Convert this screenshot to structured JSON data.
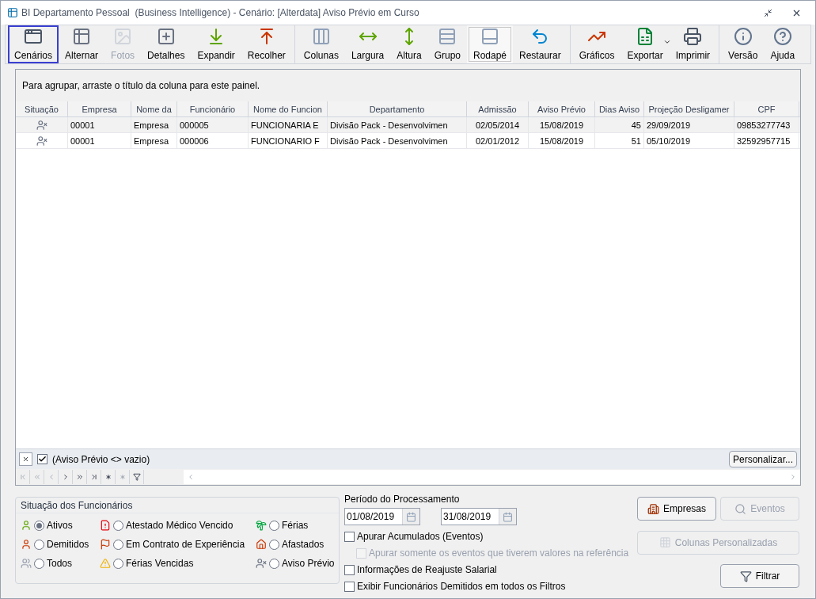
{
  "window": {
    "title": "BI Departamento Pessoal  (Business Intelligence) - Cenário: [Alterdata] Aviso Prévio em Curso"
  },
  "toolbar": [
    [
      {
        "label": "Cenários",
        "kind": "scenarios",
        "selected": true,
        "pressed": false,
        "disabled": false
      },
      {
        "label": "Alternar",
        "kind": "toggle",
        "selected": false,
        "pressed": false,
        "disabled": false
      },
      {
        "label": "Fotos",
        "kind": "photos",
        "selected": false,
        "pressed": false,
        "disabled": true
      },
      {
        "label": "Detalhes",
        "kind": "details",
        "selected": false,
        "pressed": false,
        "disabled": false
      },
      {
        "label": "Expandir",
        "kind": "expand",
        "selected": false,
        "pressed": false,
        "disabled": false
      },
      {
        "label": "Recolher",
        "kind": "collapse",
        "selected": false,
        "pressed": false,
        "disabled": false
      }
    ],
    [
      {
        "label": "Colunas",
        "kind": "columns",
        "selected": false,
        "pressed": false,
        "disabled": false
      },
      {
        "label": "Largura",
        "kind": "width",
        "selected": false,
        "pressed": false,
        "disabled": false
      },
      {
        "label": "Altura",
        "kind": "height",
        "selected": false,
        "pressed": false,
        "disabled": false
      },
      {
        "label": "Grupo",
        "kind": "group",
        "selected": false,
        "pressed": false,
        "disabled": false
      },
      {
        "label": "Rodapé",
        "kind": "footer",
        "selected": false,
        "pressed": true,
        "disabled": false
      },
      {
        "label": "Restaurar",
        "kind": "restore",
        "selected": false,
        "pressed": false,
        "disabled": false
      }
    ],
    [
      {
        "label": "Gráficos",
        "kind": "charts",
        "selected": false,
        "pressed": false,
        "disabled": false
      },
      {
        "label": "Exportar",
        "kind": "export",
        "selected": false,
        "pressed": false,
        "disabled": false,
        "dropdown": true
      },
      {
        "label": "Imprimir",
        "kind": "print",
        "selected": false,
        "pressed": false,
        "disabled": false
      }
    ],
    [
      {
        "label": "Versão",
        "kind": "info",
        "selected": false,
        "pressed": false,
        "disabled": false
      },
      {
        "label": "Ajuda",
        "kind": "help",
        "selected": false,
        "pressed": false,
        "disabled": false
      }
    ]
  ],
  "group_panel": {
    "hint": "Para agrupar, arraste o título da coluna para este painel."
  },
  "table": {
    "columns": [
      "Situação",
      "Empresa",
      "Nome da",
      "Funcionário",
      "Nome do Funcion",
      "Departamento",
      "Admissão",
      "Aviso Prévio",
      "Dias Aviso",
      "Projeção Desligamer",
      "CPF"
    ],
    "rows": [
      [
        "",
        "00001",
        "Empresa",
        "000005",
        "FUNCIONARIA E",
        "Divisão Pack - Desenvolvimen",
        "02/05/2014",
        "15/08/2019",
        "45",
        "29/09/2019",
        "09853277743"
      ],
      [
        "",
        "00001",
        "Empresa",
        "000006",
        "FUNCIONARIO F",
        "Divisão Pack - Desenvolvimen",
        "02/01/2012",
        "15/08/2019",
        "51",
        "05/10/2019",
        "32592957715"
      ]
    ]
  },
  "filter_bar": {
    "enabled": true,
    "text": "(Aviso Prévio <> vazio)",
    "button": "Personalizar..."
  },
  "situacao": {
    "title": "Situação dos Funcionários",
    "options": [
      {
        "label": "Ativos",
        "kind": "active",
        "selected": true
      },
      {
        "label": "Atestado Médico Vencido",
        "kind": "medical",
        "selected": false
      },
      {
        "label": "Férias",
        "kind": "vacation",
        "selected": false
      },
      {
        "label": "Demitidos",
        "kind": "fired",
        "selected": false
      },
      {
        "label": "Em Contrato de Experiência",
        "kind": "trial",
        "selected": false
      },
      {
        "label": "Afastados",
        "kind": "leave",
        "selected": false
      },
      {
        "label": "Todos",
        "kind": "all",
        "selected": false
      },
      {
        "label": "Férias Vencidas",
        "kind": "warning",
        "selected": false
      },
      {
        "label": "Aviso Prévio",
        "kind": "notice",
        "selected": false
      }
    ]
  },
  "periodo": {
    "title": "Período do Processamento",
    "start": "01/08/2019",
    "end": "31/08/2019"
  },
  "options": [
    {
      "label": "Apurar Acumulados (Eventos)",
      "checked": false,
      "disabled": false,
      "nested": false
    },
    {
      "label": "Apurar somente os eventos que tiverem valores na referência",
      "checked": false,
      "disabled": true,
      "nested": true
    },
    {
      "label": "Informações de Reajuste Salarial",
      "checked": false,
      "disabled": false,
      "nested": false
    },
    {
      "label": "Exibir Funcionários Demitidos em todos os Filtros",
      "checked": false,
      "disabled": false,
      "nested": false
    }
  ],
  "buttons": [
    {
      "label": "Empresas",
      "kind": "companies",
      "disabled": false
    },
    {
      "label": "Eventos",
      "kind": "search",
      "disabled": true
    },
    {
      "label": "Colunas Personalizadas",
      "kind": "grid",
      "disabled": true
    },
    {
      "label": "Filtrar",
      "kind": "filter",
      "disabled": false
    }
  ]
}
